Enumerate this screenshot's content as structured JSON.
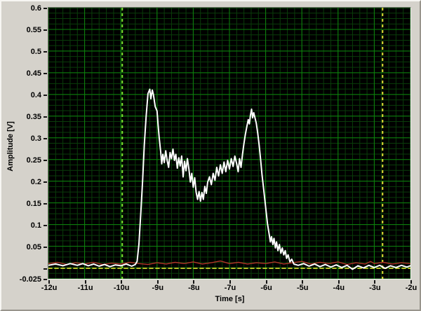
{
  "colors": {
    "frame_bg": "#d5d2cb",
    "plot_bg": "#000000",
    "grid_major": "#0d840d",
    "grid_minor": "#0a3d0a",
    "trace_white": "#ffffff",
    "trace_red": "#b03328",
    "trace_yellow": "#dedc30",
    "cursor_left": "#7ce22e",
    "cursor_right": "#e0de33",
    "label_text": "#000000"
  },
  "chart_data": {
    "type": "line",
    "title": "",
    "xlabel": "Time [s]",
    "ylabel": "Amplitude [V]",
    "xlim": [
      -12,
      -2
    ],
    "ylim": [
      -0.025,
      0.6
    ],
    "x_unit_suffix": "u",
    "grid": {
      "x_major_step": 1,
      "x_minor_step": 0.2,
      "y_major_step": 0.05,
      "y_minor_step": 0.0125
    },
    "legend_position": "none",
    "x_ticks": [
      {
        "value": -12,
        "label": "-12u"
      },
      {
        "value": -11,
        "label": "-11u"
      },
      {
        "value": -10,
        "label": "-10u"
      },
      {
        "value": -9,
        "label": "-9u"
      },
      {
        "value": -8,
        "label": "-8u"
      },
      {
        "value": -7,
        "label": "-7u"
      },
      {
        "value": -6,
        "label": "-6u"
      },
      {
        "value": -5,
        "label": "-5u"
      },
      {
        "value": -4,
        "label": "-4u"
      },
      {
        "value": -3,
        "label": "-3u"
      },
      {
        "value": -2,
        "label": "-2u"
      }
    ],
    "y_ticks": [
      {
        "value": 0.6,
        "label": "0.6"
      },
      {
        "value": 0.55,
        "label": "0.55"
      },
      {
        "value": 0.5,
        "label": "0.5"
      },
      {
        "value": 0.45,
        "label": "0.45"
      },
      {
        "value": 0.4,
        "label": "0.4"
      },
      {
        "value": 0.35,
        "label": "0.35"
      },
      {
        "value": 0.3,
        "label": "0.3"
      },
      {
        "value": 0.25,
        "label": "0.25"
      },
      {
        "value": 0.2,
        "label": "0.2"
      },
      {
        "value": 0.15,
        "label": "0.15"
      },
      {
        "value": 0.1,
        "label": "0.1"
      },
      {
        "value": 0.05,
        "label": "0.05"
      },
      {
        "value": 0,
        "label": ""
      },
      {
        "value": -0.025,
        "label": "-0.025"
      }
    ],
    "cursors": [
      {
        "orient": "vertical",
        "x": -9.96,
        "color": "#7ce22e",
        "style": "dashed"
      },
      {
        "orient": "vertical",
        "x": -2.77,
        "color": "#e0de33",
        "style": "dashed"
      }
    ],
    "series": [
      {
        "name": "yellow-trace",
        "color": "#dedc30",
        "width": 1.6,
        "dash": "5,4",
        "points": [
          [
            -12,
            -0.001
          ],
          [
            -2,
            -0.001
          ]
        ]
      },
      {
        "name": "red-trace",
        "color": "#b03328",
        "width": 1.4,
        "dash": null,
        "points": [
          [
            -12,
            0.01
          ],
          [
            -11.75,
            0.013
          ],
          [
            -11.5,
            0.008
          ],
          [
            -11.25,
            0.012
          ],
          [
            -11,
            0.009
          ],
          [
            -10.75,
            0.013
          ],
          [
            -10.5,
            0.008
          ],
          [
            -10.25,
            0.011
          ],
          [
            -10,
            0.009
          ],
          [
            -9.75,
            0.013
          ],
          [
            -9.5,
            0.01
          ],
          [
            -9.25,
            0.008
          ],
          [
            -9,
            0.012
          ],
          [
            -8.75,
            0.009
          ],
          [
            -8.5,
            0.013
          ],
          [
            -8.25,
            0.01
          ],
          [
            -8,
            0.014
          ],
          [
            -7.75,
            0.009
          ],
          [
            -7.5,
            0.012
          ],
          [
            -7.25,
            0.016
          ],
          [
            -7,
            0.01
          ],
          [
            -6.75,
            0.013
          ],
          [
            -6.5,
            0.009
          ],
          [
            -6.25,
            0.012
          ],
          [
            -6,
            0.01
          ],
          [
            -5.75,
            0.014
          ],
          [
            -5.5,
            0.009
          ],
          [
            -5.25,
            0.012
          ],
          [
            -5,
            0.015
          ],
          [
            -4.75,
            0.009
          ],
          [
            -4.5,
            0.013
          ],
          [
            -4.25,
            0.01
          ],
          [
            -4,
            0.014
          ],
          [
            -3.75,
            0.008
          ],
          [
            -3.5,
            0.012
          ],
          [
            -3.25,
            0.009
          ],
          [
            -3.1,
            0.015
          ],
          [
            -3,
            0.01
          ],
          [
            -2.75,
            0.013
          ],
          [
            -2.5,
            0.009
          ],
          [
            -2.25,
            0.012
          ],
          [
            -2,
            0.01
          ]
        ]
      },
      {
        "name": "white-trace",
        "color": "#ffffff",
        "width": 2,
        "dash": null,
        "points": [
          [
            -12,
            0.006
          ],
          [
            -11.8,
            0.009
          ],
          [
            -11.6,
            0.005
          ],
          [
            -11.4,
            0.01
          ],
          [
            -11.2,
            0.006
          ],
          [
            -11.05,
            0.01
          ],
          [
            -10.9,
            0.005
          ],
          [
            -10.75,
            0.009
          ],
          [
            -10.6,
            0.004
          ],
          [
            -10.45,
            0.008
          ],
          [
            -10.3,
            0.003
          ],
          [
            -10.15,
            0.007
          ],
          [
            -10,
            0.005
          ],
          [
            -9.85,
            0.009
          ],
          [
            -9.7,
            0.004
          ],
          [
            -9.6,
            0.008
          ],
          [
            -9.55,
            0.015
          ],
          [
            -9.5,
            0.055
          ],
          [
            -9.45,
            0.125
          ],
          [
            -9.4,
            0.2
          ],
          [
            -9.35,
            0.285
          ],
          [
            -9.3,
            0.35
          ],
          [
            -9.25,
            0.402
          ],
          [
            -9.2,
            0.412
          ],
          [
            -9.17,
            0.39
          ],
          [
            -9.13,
            0.41
          ],
          [
            -9.1,
            0.4
          ],
          [
            -9.05,
            0.372
          ],
          [
            -9,
            0.362
          ],
          [
            -8.97,
            0.33
          ],
          [
            -8.94,
            0.3
          ],
          [
            -8.9,
            0.268
          ],
          [
            -8.87,
            0.24
          ],
          [
            -8.84,
            0.262
          ],
          [
            -8.8,
            0.243
          ],
          [
            -8.76,
            0.27
          ],
          [
            -8.72,
            0.248
          ],
          [
            -8.68,
            0.232
          ],
          [
            -8.64,
            0.266
          ],
          [
            -8.6,
            0.252
          ],
          [
            -8.56,
            0.274
          ],
          [
            -8.52,
            0.248
          ],
          [
            -8.48,
            0.262
          ],
          [
            -8.44,
            0.23
          ],
          [
            -8.4,
            0.254
          ],
          [
            -8.36,
            0.235
          ],
          [
            -8.32,
            0.258
          ],
          [
            -8.28,
            0.21
          ],
          [
            -8.24,
            0.246
          ],
          [
            -8.2,
            0.224
          ],
          [
            -8.16,
            0.252
          ],
          [
            -8.12,
            0.228
          ],
          [
            -8.08,
            0.198
          ],
          [
            -8.04,
            0.218
          ],
          [
            -8,
            0.186
          ],
          [
            -7.96,
            0.208
          ],
          [
            -7.92,
            0.175
          ],
          [
            -7.88,
            0.158
          ],
          [
            -7.84,
            0.176
          ],
          [
            -7.8,
            0.154
          ],
          [
            -7.76,
            0.174
          ],
          [
            -7.72,
            0.158
          ],
          [
            -7.68,
            0.188
          ],
          [
            -7.64,
            0.172
          ],
          [
            -7.6,
            0.198
          ],
          [
            -7.55,
            0.21
          ],
          [
            -7.5,
            0.192
          ],
          [
            -7.45,
            0.218
          ],
          [
            -7.4,
            0.202
          ],
          [
            -7.35,
            0.232
          ],
          [
            -7.3,
            0.212
          ],
          [
            -7.25,
            0.238
          ],
          [
            -7.2,
            0.218
          ],
          [
            -7.15,
            0.244
          ],
          [
            -7.1,
            0.222
          ],
          [
            -7.05,
            0.248
          ],
          [
            -7,
            0.228
          ],
          [
            -6.95,
            0.252
          ],
          [
            -6.9,
            0.234
          ],
          [
            -6.85,
            0.258
          ],
          [
            -6.8,
            0.24
          ],
          [
            -6.76,
            0.222
          ],
          [
            -6.72,
            0.252
          ],
          [
            -6.68,
            0.232
          ],
          [
            -6.64,
            0.262
          ],
          [
            -6.6,
            0.286
          ],
          [
            -6.56,
            0.308
          ],
          [
            -6.52,
            0.326
          ],
          [
            -6.48,
            0.342
          ],
          [
            -6.45,
            0.332
          ],
          [
            -6.42,
            0.352
          ],
          [
            -6.39,
            0.366
          ],
          [
            -6.36,
            0.346
          ],
          [
            -6.33,
            0.358
          ],
          [
            -6.3,
            0.348
          ],
          [
            -6.26,
            0.334
          ],
          [
            -6.22,
            0.312
          ],
          [
            -6.18,
            0.284
          ],
          [
            -6.14,
            0.25
          ],
          [
            -6.1,
            0.215
          ],
          [
            -6.05,
            0.178
          ],
          [
            -6,
            0.14
          ],
          [
            -5.95,
            0.102
          ],
          [
            -5.9,
            0.076
          ],
          [
            -5.87,
            0.06
          ],
          [
            -5.84,
            0.072
          ],
          [
            -5.8,
            0.054
          ],
          [
            -5.77,
            0.068
          ],
          [
            -5.73,
            0.046
          ],
          [
            -5.7,
            0.06
          ],
          [
            -5.66,
            0.04
          ],
          [
            -5.62,
            0.054
          ],
          [
            -5.58,
            0.034
          ],
          [
            -5.54,
            0.046
          ],
          [
            -5.5,
            0.03
          ],
          [
            -5.46,
            0.04
          ],
          [
            -5.42,
            0.022
          ],
          [
            -5.38,
            0.03
          ],
          [
            -5.33,
            0.014
          ],
          [
            -5.28,
            0.02
          ],
          [
            -5.22,
            0.009
          ],
          [
            -5.1,
            0.006
          ],
          [
            -4.95,
            0.01
          ],
          [
            -4.8,
            0.004
          ],
          [
            -4.65,
            0.009
          ],
          [
            -4.5,
            0.003
          ],
          [
            -4.35,
            0.008
          ],
          [
            -4.2,
            0.002
          ],
          [
            -4.05,
            0.007
          ],
          [
            -3.9,
            0.001
          ],
          [
            -3.75,
            0.006
          ],
          [
            -3.6,
            -0.003
          ],
          [
            -3.45,
            0.005
          ],
          [
            -3.3,
            0.0
          ],
          [
            -3.15,
            0.006
          ],
          [
            -3,
            0.001
          ],
          [
            -2.85,
            0.006
          ],
          [
            -2.7,
            -0.001
          ],
          [
            -2.55,
            0.005
          ],
          [
            -2.4,
            0.001
          ],
          [
            -2.25,
            0.006
          ],
          [
            -2.1,
            0.002
          ],
          [
            -2,
            0.005
          ]
        ]
      }
    ]
  }
}
